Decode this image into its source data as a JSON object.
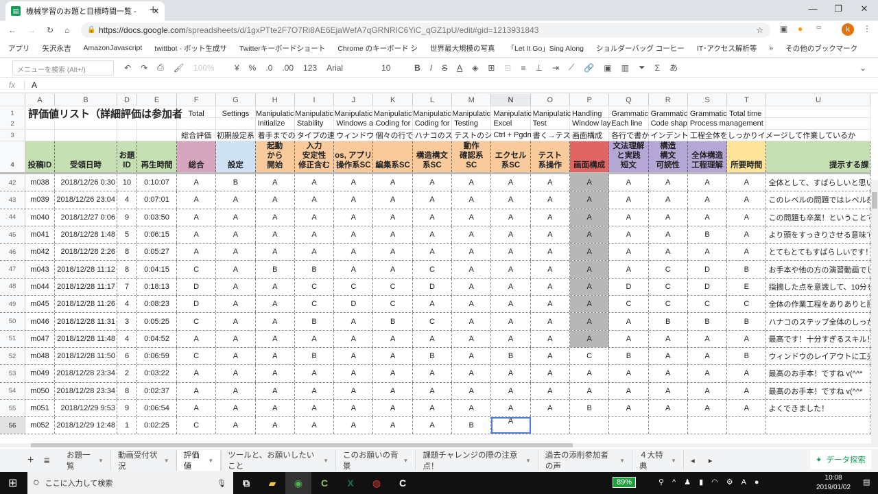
{
  "browser": {
    "tab_title": "機械学習のお題と目標時間一覧 - ",
    "url_host": "https://docs.google.com",
    "url_path": "/spreadsheets/d/1gxPTte2F7O7Ri8AE6EjaWefA7qGRNRIC6YiC_qGZ1pU/edit#gid=1213931843",
    "profile_initial": "k",
    "bookmarks": [
      "アプリ",
      "矢沢永吉",
      "AmazonJavascript",
      "twittbot - ボット生成サ",
      "Twitterキーボードショート",
      "Chrome のキーボード シ",
      "世界最大規模の写真",
      "「Let It Go」Sing Along",
      "ショルダーバッグ コーヒー",
      "IT･アクセス解析等",
      "»",
      "その他のブックマーク"
    ]
  },
  "toolbar": {
    "menu_search_placeholder": "メニューを検索 (Alt+/)",
    "zoom": "100%",
    "currency": "¥",
    "percent": "%",
    "dec_less": ".0",
    "dec_more": ".00",
    "format": "123",
    "font": "Arial",
    "font_size": "10",
    "ime": "あ"
  },
  "formula": {
    "fx": "fx",
    "value": "A"
  },
  "columns": [
    "A",
    "B",
    "D",
    "E",
    "F",
    "G",
    "H",
    "I",
    "J",
    "K",
    "L",
    "M",
    "N",
    "O",
    "P",
    "Q",
    "R",
    "S",
    "T",
    "U"
  ],
  "selected_column": "N",
  "header_rows": {
    "title": "評価値リスト（詳細評価は参加者",
    "row1": [
      "Total",
      "Settings",
      "Manipulatic",
      "Manipulatic",
      "Manipulatic",
      "Manipulatic",
      "Manipulatic",
      "Manipulatic",
      "Manipulatic",
      "Manipulatic",
      "Handling",
      "Grammatic",
      "Grammatic",
      "Grammatic",
      "Total time"
    ],
    "row2": [
      "",
      "",
      "Initialize",
      "Stability",
      "Windows a",
      "Coding for",
      "Coding for",
      "Testing",
      "Excel",
      "Test",
      "Window lay",
      "Each line",
      "Code shap",
      "Process management",
      ""
    ],
    "row3": [
      "総合評価",
      "初期設定系",
      "着手までの",
      "タイプの速",
      "ウィンドウ",
      "個々の行で",
      "ハナコのス",
      "テストのシ",
      "Ctrl + Pgdn",
      "書く→テス",
      "画面構成",
      "各行で書か",
      "インデント",
      "工程全体をしっかりイメージして作業しているか",
      ""
    ],
    "row4": [
      "投稿ID",
      "受領日時",
      "お題\nID",
      "再生時間",
      "総合",
      "設定",
      "起動\nから\n開始",
      "入力\n安定性\n修正含む",
      "os, アプリ\n操作系SC",
      "編集系SC",
      "構造構文\n系SC",
      "動作\n確認系\nSC",
      "エクセル\n系SC",
      "テスト\n系操作",
      "画面構成",
      "文法理解\nと実践\n短文",
      "構造\n構文\n可読性",
      "全体構造\n工程理解",
      "所要時間",
      "提示する課"
    ],
    "row4_colors": [
      "#c6e0b4",
      "#c6e0b4",
      "#c6e0b4",
      "#c6e0b4",
      "#d5a6bd",
      "#cfe2f3",
      "#f9cb9c",
      "#f9cb9c",
      "#f9cb9c",
      "#f9cb9c",
      "#f9cb9c",
      "#f9cb9c",
      "#f9cb9c",
      "#f9cb9c",
      "#e06666",
      "#b4a7d6",
      "#b4a7d6",
      "#b4a7d6",
      "#ffe599",
      "#c6e0b4"
    ]
  },
  "rows": [
    {
      "n": "42",
      "id": "m038",
      "date": "2018/12/26 0:30",
      "topic": "10",
      "time": "0:10:07",
      "g": [
        "A",
        "B",
        "A",
        "A",
        "A",
        "A",
        "A",
        "A",
        "A",
        "A",
        "A",
        "A",
        "A",
        "A",
        "A"
      ],
      "c": "全体として、すばらしいと思い"
    },
    {
      "n": "43",
      "id": "m039",
      "date": "2018/12/26 23:04",
      "topic": "4",
      "time": "0:07:01",
      "g": [
        "A",
        "A",
        "A",
        "A",
        "A",
        "A",
        "A",
        "A",
        "A",
        "A",
        "A",
        "A",
        "A",
        "A",
        "A"
      ],
      "c": "このレベルの問題ではレベル感"
    },
    {
      "n": "44",
      "id": "m040",
      "date": "2018/12/27 0:06",
      "topic": "9",
      "time": "0:03:50",
      "g": [
        "A",
        "A",
        "A",
        "A",
        "A",
        "A",
        "A",
        "A",
        "A",
        "A",
        "A",
        "A",
        "A",
        "A",
        "A"
      ],
      "c": "この問題も卒業！ということで"
    },
    {
      "n": "45",
      "id": "m041",
      "date": "2018/12/28 1:48",
      "topic": "5",
      "time": "0:06:15",
      "g": [
        "A",
        "A",
        "A",
        "A",
        "A",
        "A",
        "A",
        "A",
        "A",
        "A",
        "A",
        "A",
        "A",
        "B",
        "A"
      ],
      "c": "より頭をすっきりさせる意味で"
    },
    {
      "n": "46",
      "id": "m042",
      "date": "2018/12/28 2:26",
      "topic": "8",
      "time": "0:05:27",
      "g": [
        "A",
        "A",
        "A",
        "A",
        "A",
        "A",
        "A",
        "A",
        "A",
        "A",
        "A",
        "A",
        "A",
        "A",
        "A"
      ],
      "c": "とてもとてもすばらしいです！"
    },
    {
      "n": "47",
      "id": "m043",
      "date": "2018/12/28 11:12",
      "topic": "8",
      "time": "0:04:15",
      "g": [
        "C",
        "A",
        "B",
        "B",
        "A",
        "A",
        "C",
        "A",
        "A",
        "A",
        "A",
        "A",
        "C",
        "D",
        "B"
      ],
      "c": "お手本や他の方の演習動画でし"
    },
    {
      "n": "48",
      "id": "m044",
      "date": "2018/12/28 11:17",
      "topic": "7",
      "time": "0:18:13",
      "g": [
        "D",
        "A",
        "A",
        "C",
        "C",
        "C",
        "D",
        "A",
        "A",
        "A",
        "A",
        "D",
        "C",
        "D",
        "E"
      ],
      "c": "指摘した点を意識して、10分を"
    },
    {
      "n": "49",
      "id": "m045",
      "date": "2018/12/28 11:26",
      "topic": "4",
      "time": "0:08:23",
      "g": [
        "D",
        "A",
        "A",
        "C",
        "D",
        "C",
        "A",
        "A",
        "A",
        "A",
        "A",
        "C",
        "C",
        "C",
        "C"
      ],
      "c": "全体の作業工程をありありと脳"
    },
    {
      "n": "50",
      "id": "m046",
      "date": "2018/12/28 11:31",
      "topic": "3",
      "time": "0:05:25",
      "g": [
        "C",
        "A",
        "A",
        "B",
        "A",
        "B",
        "C",
        "A",
        "A",
        "A",
        "A",
        "A",
        "B",
        "B",
        "B"
      ],
      "c": "ハナコのステップ全体のしっか"
    },
    {
      "n": "51",
      "id": "m047",
      "date": "2018/12/28 11:48",
      "topic": "4",
      "time": "0:04:52",
      "g": [
        "A",
        "A",
        "A",
        "A",
        "A",
        "A",
        "A",
        "A",
        "A",
        "A",
        "A",
        "A",
        "A",
        "A",
        "A"
      ],
      "c": "最高です！十分すぎるスキル！"
    },
    {
      "n": "52",
      "id": "m048",
      "date": "2018/12/28 11:50",
      "topic": "6",
      "time": "0:06:59",
      "g": [
        "C",
        "A",
        "A",
        "B",
        "A",
        "A",
        "B",
        "A",
        "B",
        "A",
        "C",
        "B",
        "A",
        "A",
        "B"
      ],
      "c": "ウィンドウのレイアウトに工夫"
    },
    {
      "n": "53",
      "id": "m049",
      "date": "2018/12/28 23:34",
      "topic": "2",
      "time": "0:03:22",
      "g": [
        "A",
        "A",
        "A",
        "A",
        "A",
        "A",
        "A",
        "A",
        "A",
        "A",
        "A",
        "A",
        "A",
        "A",
        "A"
      ],
      "c": "最高のお手本！ですね v(^^*"
    },
    {
      "n": "54",
      "id": "m050",
      "date": "2018/12/28 23:34",
      "topic": "8",
      "time": "0:02:37",
      "g": [
        "A",
        "A",
        "A",
        "A",
        "A",
        "A",
        "A",
        "A",
        "A",
        "A",
        "A",
        "A",
        "A",
        "A",
        "A"
      ],
      "c": "最高のお手本！ですね v(^^*"
    },
    {
      "n": "55",
      "id": "m051",
      "date": "2018/12/29 9:53",
      "topic": "9",
      "time": "0:06:54",
      "g": [
        "A",
        "A",
        "A",
        "A",
        "A",
        "A",
        "A",
        "A",
        "A",
        "A",
        "B",
        "A",
        "A",
        "A",
        "A"
      ],
      "c": "よくできました！"
    },
    {
      "n": "56",
      "id": "m052",
      "date": "2018/12/29 12:48",
      "topic": "1",
      "time": "0:02:25",
      "g": [
        "C",
        "A",
        "A",
        "A",
        "A",
        "A",
        "A",
        "B",
        "A",
        "",
        "",
        "",
        "",
        "",
        ""
      ],
      "c": ""
    }
  ],
  "gray_rows_in_P": [
    "42",
    "43",
    "44",
    "45",
    "46",
    "47",
    "48",
    "49",
    "50",
    "51"
  ],
  "selected_cell": {
    "row": "56",
    "col": "N"
  },
  "sheet_tabs": [
    "お題一覧",
    "動画受付状況",
    "評価値",
    "ツールと、お願いしたいこと",
    "このお願いの背景",
    "課題チャレンジの際の注意点！",
    "過去の添削参加者の声",
    "４大特典"
  ],
  "active_sheet": "評価値",
  "explore_label": "データ探索",
  "taskbar": {
    "search_placeholder": "ここに入力して検索",
    "battery": "89%",
    "time": "10:08",
    "date": "2019/01/02"
  }
}
